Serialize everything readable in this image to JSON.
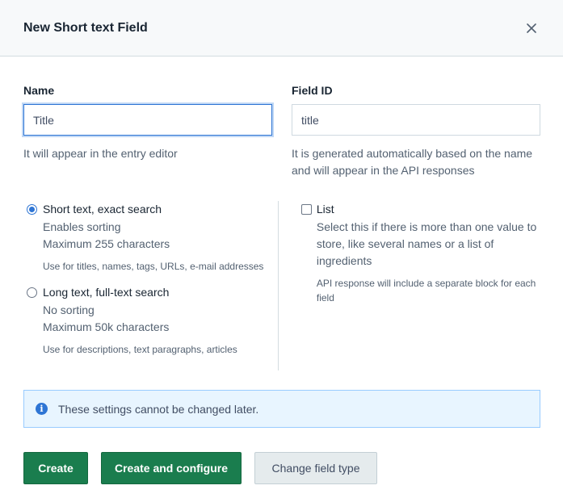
{
  "header": {
    "title": "New Short text Field"
  },
  "name_field": {
    "label": "Name",
    "value": "Title",
    "help": "It will appear in the entry editor"
  },
  "field_id": {
    "label": "Field ID",
    "value": "title",
    "help": "It is generated automatically based on the name and will appear in the API responses"
  },
  "options": {
    "short_text": {
      "title": "Short text, exact search",
      "line1": "Enables sorting",
      "line2": "Maximum 255 characters",
      "note": "Use for titles, names, tags, URLs, e-mail addresses",
      "checked": true
    },
    "long_text": {
      "title": "Long text, full-text search",
      "line1": "No sorting",
      "line2": "Maximum 50k characters",
      "note": "Use for descriptions, text paragraphs, articles",
      "checked": false
    },
    "list": {
      "title": "List",
      "description": "Select this if there is more than one value to store, like several names or a list of ingredients",
      "note": "API response will include a separate block for each field",
      "checked": false
    }
  },
  "notice": {
    "text": "These settings cannot be changed later."
  },
  "actions": {
    "create": "Create",
    "create_configure": "Create and configure",
    "change_type": "Change field type"
  },
  "colors": {
    "primary": "#1a7d4e",
    "accent_blue": "#2e75d4",
    "notice_bg": "#e8f5ff"
  }
}
